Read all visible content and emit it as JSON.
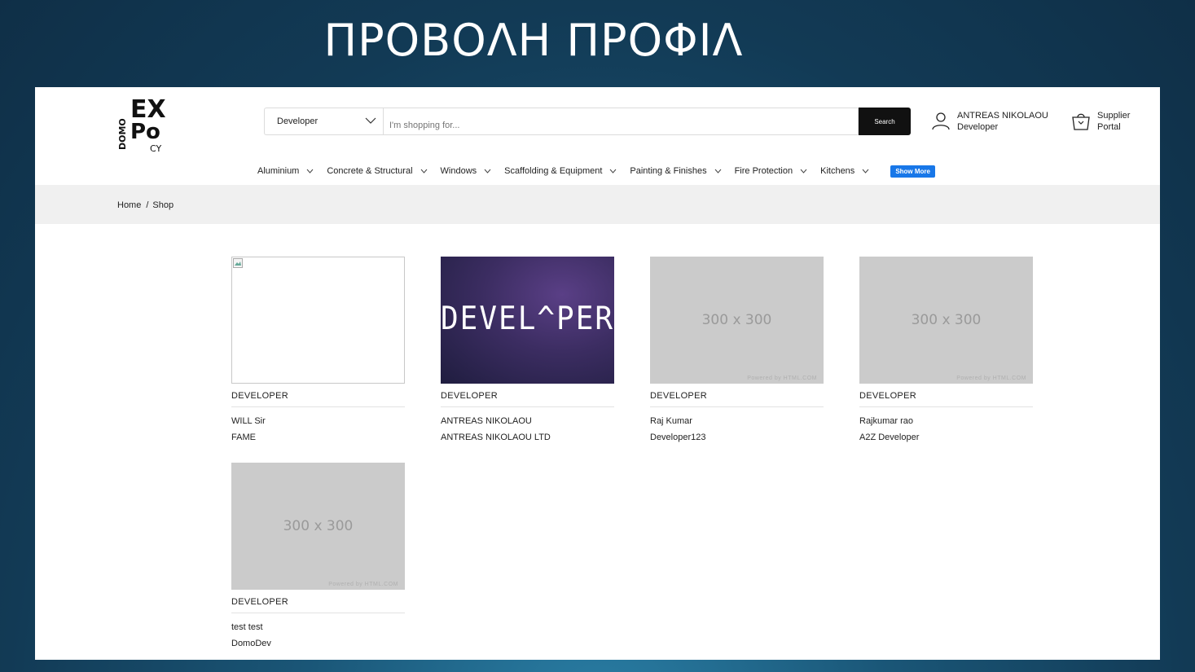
{
  "slide": {
    "title": "ΠΡΟΒΟΛΗ ΠΡΟΦΙΛ"
  },
  "header": {
    "logo_alt": "DOMO EXPO CY",
    "category_select": "Developer",
    "search_placeholder": "I'm shopping for...",
    "search_button": "Search",
    "user": {
      "name": "ANTREAS NIKOLAOU",
      "role": "Developer"
    },
    "supplier": {
      "line1": "Supplier",
      "line2": "Portal"
    }
  },
  "nav": {
    "items": [
      {
        "label": "Aluminium"
      },
      {
        "label": "Concrete & Structural"
      },
      {
        "label": "Windows"
      },
      {
        "label": "Scaffolding & Equipment"
      },
      {
        "label": "Painting & Finishes"
      },
      {
        "label": "Fire Protection"
      },
      {
        "label": "Kitchens"
      }
    ],
    "show_more": "Show More"
  },
  "breadcrumb": {
    "home": "Home",
    "sep": "/",
    "current": "Shop"
  },
  "products": [
    {
      "image": "broken",
      "category": "DEVELOPER",
      "name": "WILL Sir",
      "company": "FAME"
    },
    {
      "image": "developer-banner",
      "image_text": "DEVEL^PER",
      "category": "DEVELOPER",
      "name": "ANTREAS NIKOLAOU",
      "company": "ANTREAS NIKOLAOU LTD"
    },
    {
      "image": "placeholder",
      "image_text": "300 x 300",
      "powered": "Powered by HTML.COM",
      "category": "DEVELOPER",
      "name": "Raj Kumar",
      "company": "Developer123"
    },
    {
      "image": "placeholder",
      "image_text": "300 x 300",
      "powered": "Powered by HTML.COM",
      "category": "DEVELOPER",
      "name": "Rajkumar rao",
      "company": "A2Z Developer"
    },
    {
      "image": "placeholder",
      "image_text": "300 x 300",
      "powered": "Powered by HTML.COM",
      "category": "DEVELOPER",
      "name": "test test",
      "company": "DomoDev"
    }
  ],
  "colors": {
    "accent_button": "#1877e8",
    "search_button": "#111111",
    "breadcrumb_bg": "#f0f0f0"
  }
}
